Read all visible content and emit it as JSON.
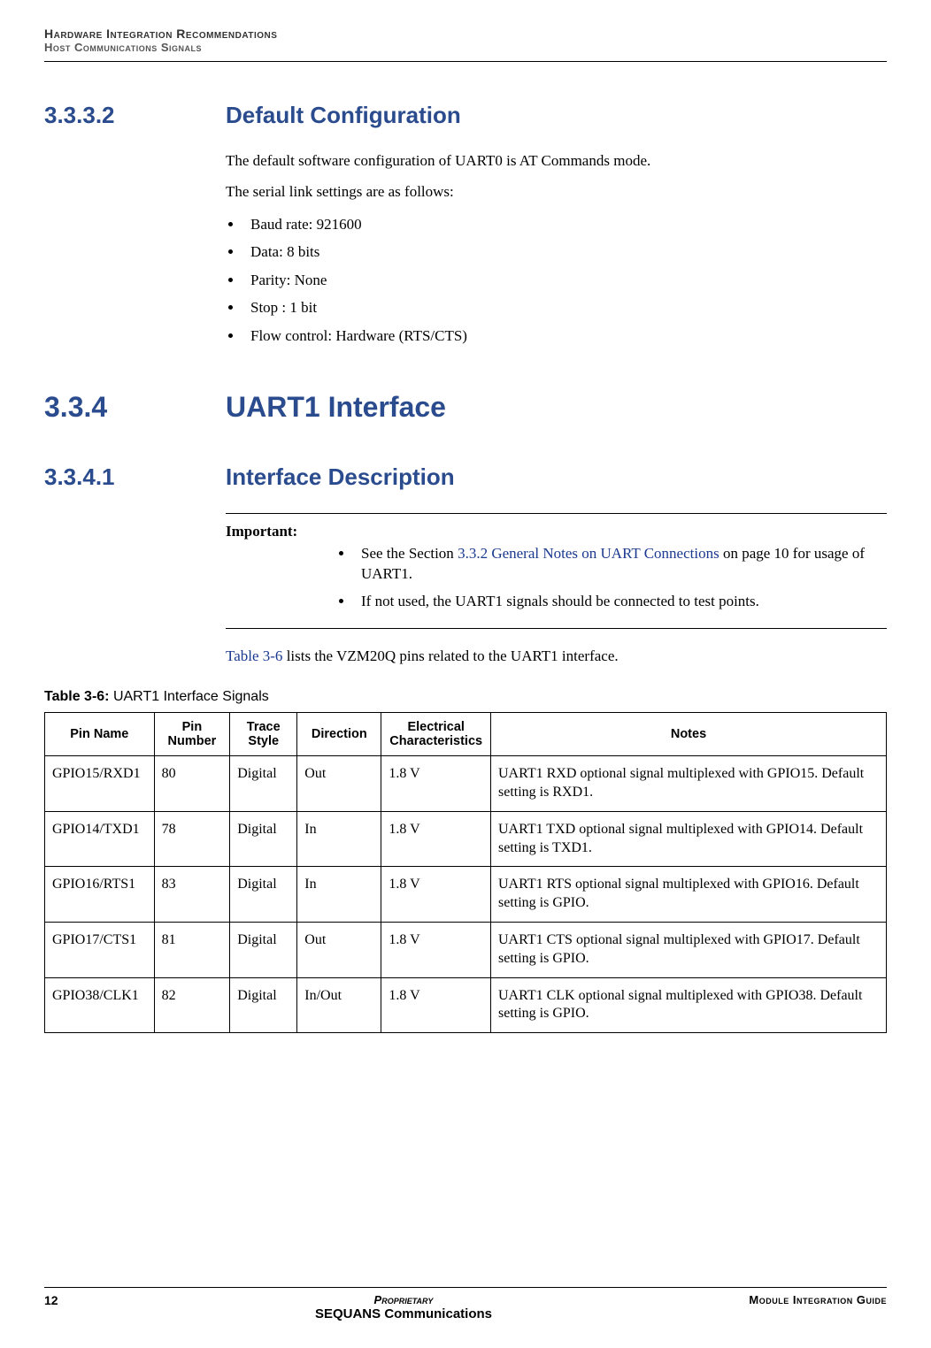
{
  "header": {
    "line1": "Hardware Integration Recommendations",
    "line2": "Host Communications Signals"
  },
  "sec1": {
    "number": "3.3.3.2",
    "title": "Default Configuration",
    "para1": "The default software configuration of UART0 is AT Commands mode.",
    "para2": "The serial link settings are as follows:",
    "bullets": [
      "Baud rate: 921600",
      "Data: 8 bits",
      "Parity: None",
      "Stop : 1 bit",
      "Flow control: Hardware (RTS/CTS)"
    ]
  },
  "sec2": {
    "number": "3.3.4",
    "title": "UART1 Interface"
  },
  "sec3": {
    "number": "3.3.4.1",
    "title": "Interface Description",
    "important_label": "Important:",
    "important_items": [
      {
        "pre": "See the Section ",
        "link": "3.3.2 General Notes on UART Connections",
        "post": " on page 10 for usage of UART1."
      },
      {
        "text": "If not used, the UART1 signals  should be connected to test points."
      }
    ],
    "ref_pre": "Table 3-6",
    "ref_post": " lists the VZM20Q pins related to the UART1 interface."
  },
  "table": {
    "caption_bold": "Table 3-6: ",
    "caption_text": "UART1 Interface Signals",
    "headers": [
      "Pin Name",
      "Pin Number",
      "Trace Style",
      "Direction",
      "Electrical Characteristics",
      "Notes"
    ],
    "rows": [
      [
        "GPIO15/RXD1",
        "80",
        "Digital",
        "Out",
        "1.8 V",
        "UART1 RXD optional signal multiplexed with GPIO15. Default setting is RXD1."
      ],
      [
        "GPIO14/TXD1",
        "78",
        "Digital",
        "In",
        "1.8 V",
        "UART1 TXD optional signal multiplexed with GPIO14. Default setting is TXD1."
      ],
      [
        "GPIO16/RTS1",
        "83",
        "Digital",
        "In",
        "1.8 V",
        "UART1 RTS optional signal multiplexed with GPIO16. Default setting is GPIO."
      ],
      [
        "GPIO17/CTS1",
        "81",
        "Digital",
        "Out",
        "1.8 V",
        "UART1 CTS optional signal multiplexed with GPIO17. Default setting is GPIO."
      ],
      [
        "GPIO38/CLK1",
        "82",
        "Digital",
        "In/Out",
        "1.8 V",
        "UART1 CLK optional signal multiplexed with GPIO38. Default setting is GPIO."
      ]
    ]
  },
  "footer": {
    "page": "12",
    "proprietary": "Proprietary",
    "company": "SEQUANS Communications",
    "right": "Module Integration Guide"
  }
}
